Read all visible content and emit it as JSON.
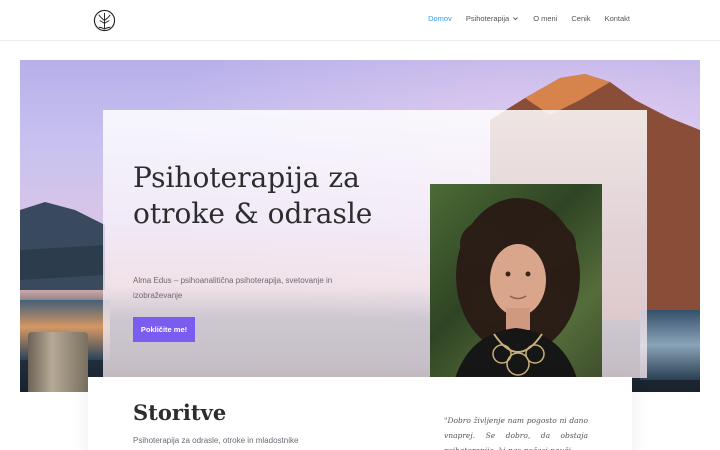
{
  "header": {
    "logo_icon": "tree-of-life-logo",
    "nav": [
      {
        "label": "Domov",
        "active": true
      },
      {
        "label": "Psihoterapija",
        "has_dropdown": true
      },
      {
        "label": "O meni"
      },
      {
        "label": "Cenik"
      },
      {
        "label": "Kontakt"
      }
    ]
  },
  "hero": {
    "title": "Psihoterapija za otroke & odrasle",
    "subtitle": "Alma Edus – psihoanalitična psihoterapija, svetovanje in izobraževanje",
    "cta_label": "Pokličite me!"
  },
  "services": {
    "title": "Storitve",
    "subtitle": "Psihoterapija za odrasle, otroke in mladostnike"
  },
  "quote": {
    "text": "\"Dobro življenje nam pogosto ni dano vnaprej. Se dobro, da obstaja psihoterapija, ki nas počasi nauči"
  },
  "colors": {
    "accent": "#7b5cf0",
    "nav_active": "#2ea3f2"
  }
}
